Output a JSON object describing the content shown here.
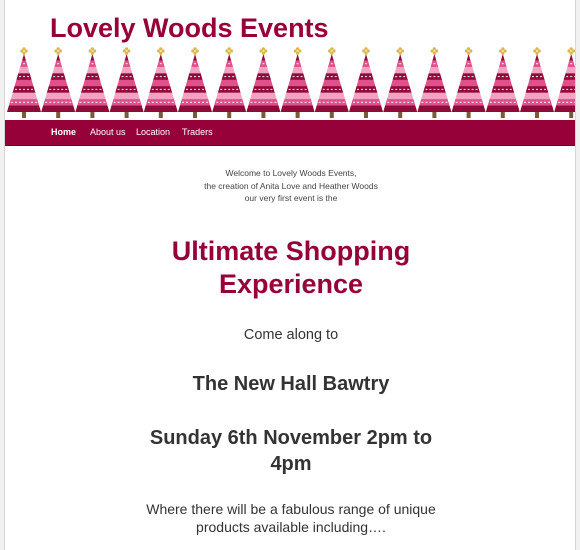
{
  "site": {
    "title": "Lovely Woods Events"
  },
  "colors": {
    "brand": "#97013a",
    "tree_dark": "#8e0b3a",
    "tree_pink": "#e0508a",
    "tree_light": "#f2a3c3",
    "star": "#d9b650"
  },
  "banner": {
    "icon": "christmas-tree-icon",
    "tree_count": 17
  },
  "nav": {
    "items": [
      {
        "label": "Home",
        "active": true
      },
      {
        "label": "About us",
        "active": false
      },
      {
        "label": "Location",
        "active": false
      },
      {
        "label": "Traders",
        "active": false
      }
    ]
  },
  "intro": {
    "line1": "Welcome to Lovely Woods Events,",
    "line2": "the creation of Anita Love and Heather Woods",
    "line3": "our very first event is the"
  },
  "event": {
    "headline_1": "Ultimate Shopping",
    "headline_2": "Experience",
    "come_along": "Come along to",
    "venue": "The New Hall Bawtry",
    "date_1": "Sunday 6th November 2pm to",
    "date_2": "4pm",
    "range_1": "Where there will be a fabulous range of unique",
    "range_2": "products available including…."
  }
}
